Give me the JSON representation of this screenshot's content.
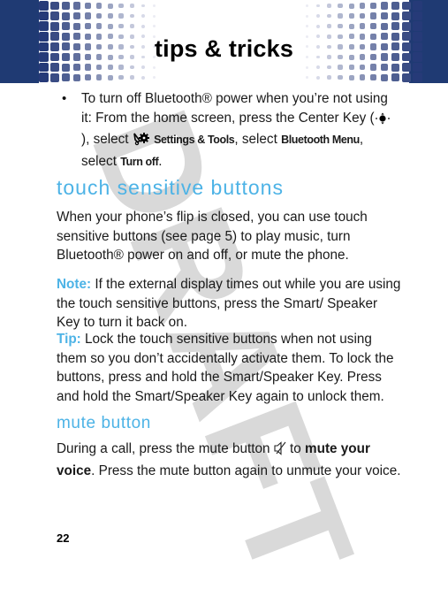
{
  "header": {
    "title": "tips & tricks",
    "band_color": "#1f3a73"
  },
  "watermark": {
    "text": "DRAFT",
    "color": "#d9d9d9"
  },
  "bullet": {
    "text_before_key": "To turn off Bluetooth® power when you’re not using it: From the home screen, press the Center Key (",
    "center_key_icon": "center-key-icon",
    "text_after_key": "), select ",
    "settings_icon": "settings-tools-icon",
    "settings_label": "Settings & Tools",
    "text_select": ", select ",
    "bluetooth_menu_label": "Bluetooth Menu",
    "text_select2": ", select ",
    "turn_off_label": "Turn off",
    "text_end": "."
  },
  "section_touch": {
    "heading": "touch sensitive buttons",
    "intro": "When your phone’s flip is closed, you can use touch sensitive buttons (see page 5) to play music, turn Bluetooth® power on and off, or mute the phone.",
    "note_label": "Note:",
    "note_text": " If the external display times out while you are using the touch sensitive buttons, press the Smart/ Speaker Key to turn it back on.",
    "tip_label": "Tip:",
    "tip_text": " Lock the touch sensitive buttons when not using them so you don’t accidentally activate them. To lock the buttons, press and hold the Smart/Speaker Key. Press and hold the Smart/Speaker Key again to unlock them."
  },
  "section_mute": {
    "heading": "mute button",
    "text_before_icon": "During a call, press the mute button ",
    "mute_icon": "mute-icon",
    "text_to": " to ",
    "bold_text": "mute your voice",
    "text_after": ". Press the mute button again to unmute your voice."
  },
  "footer": {
    "page_number": "22"
  },
  "colors": {
    "heading_accent": "#4db3e6",
    "body_text": "#1a1a1a"
  }
}
